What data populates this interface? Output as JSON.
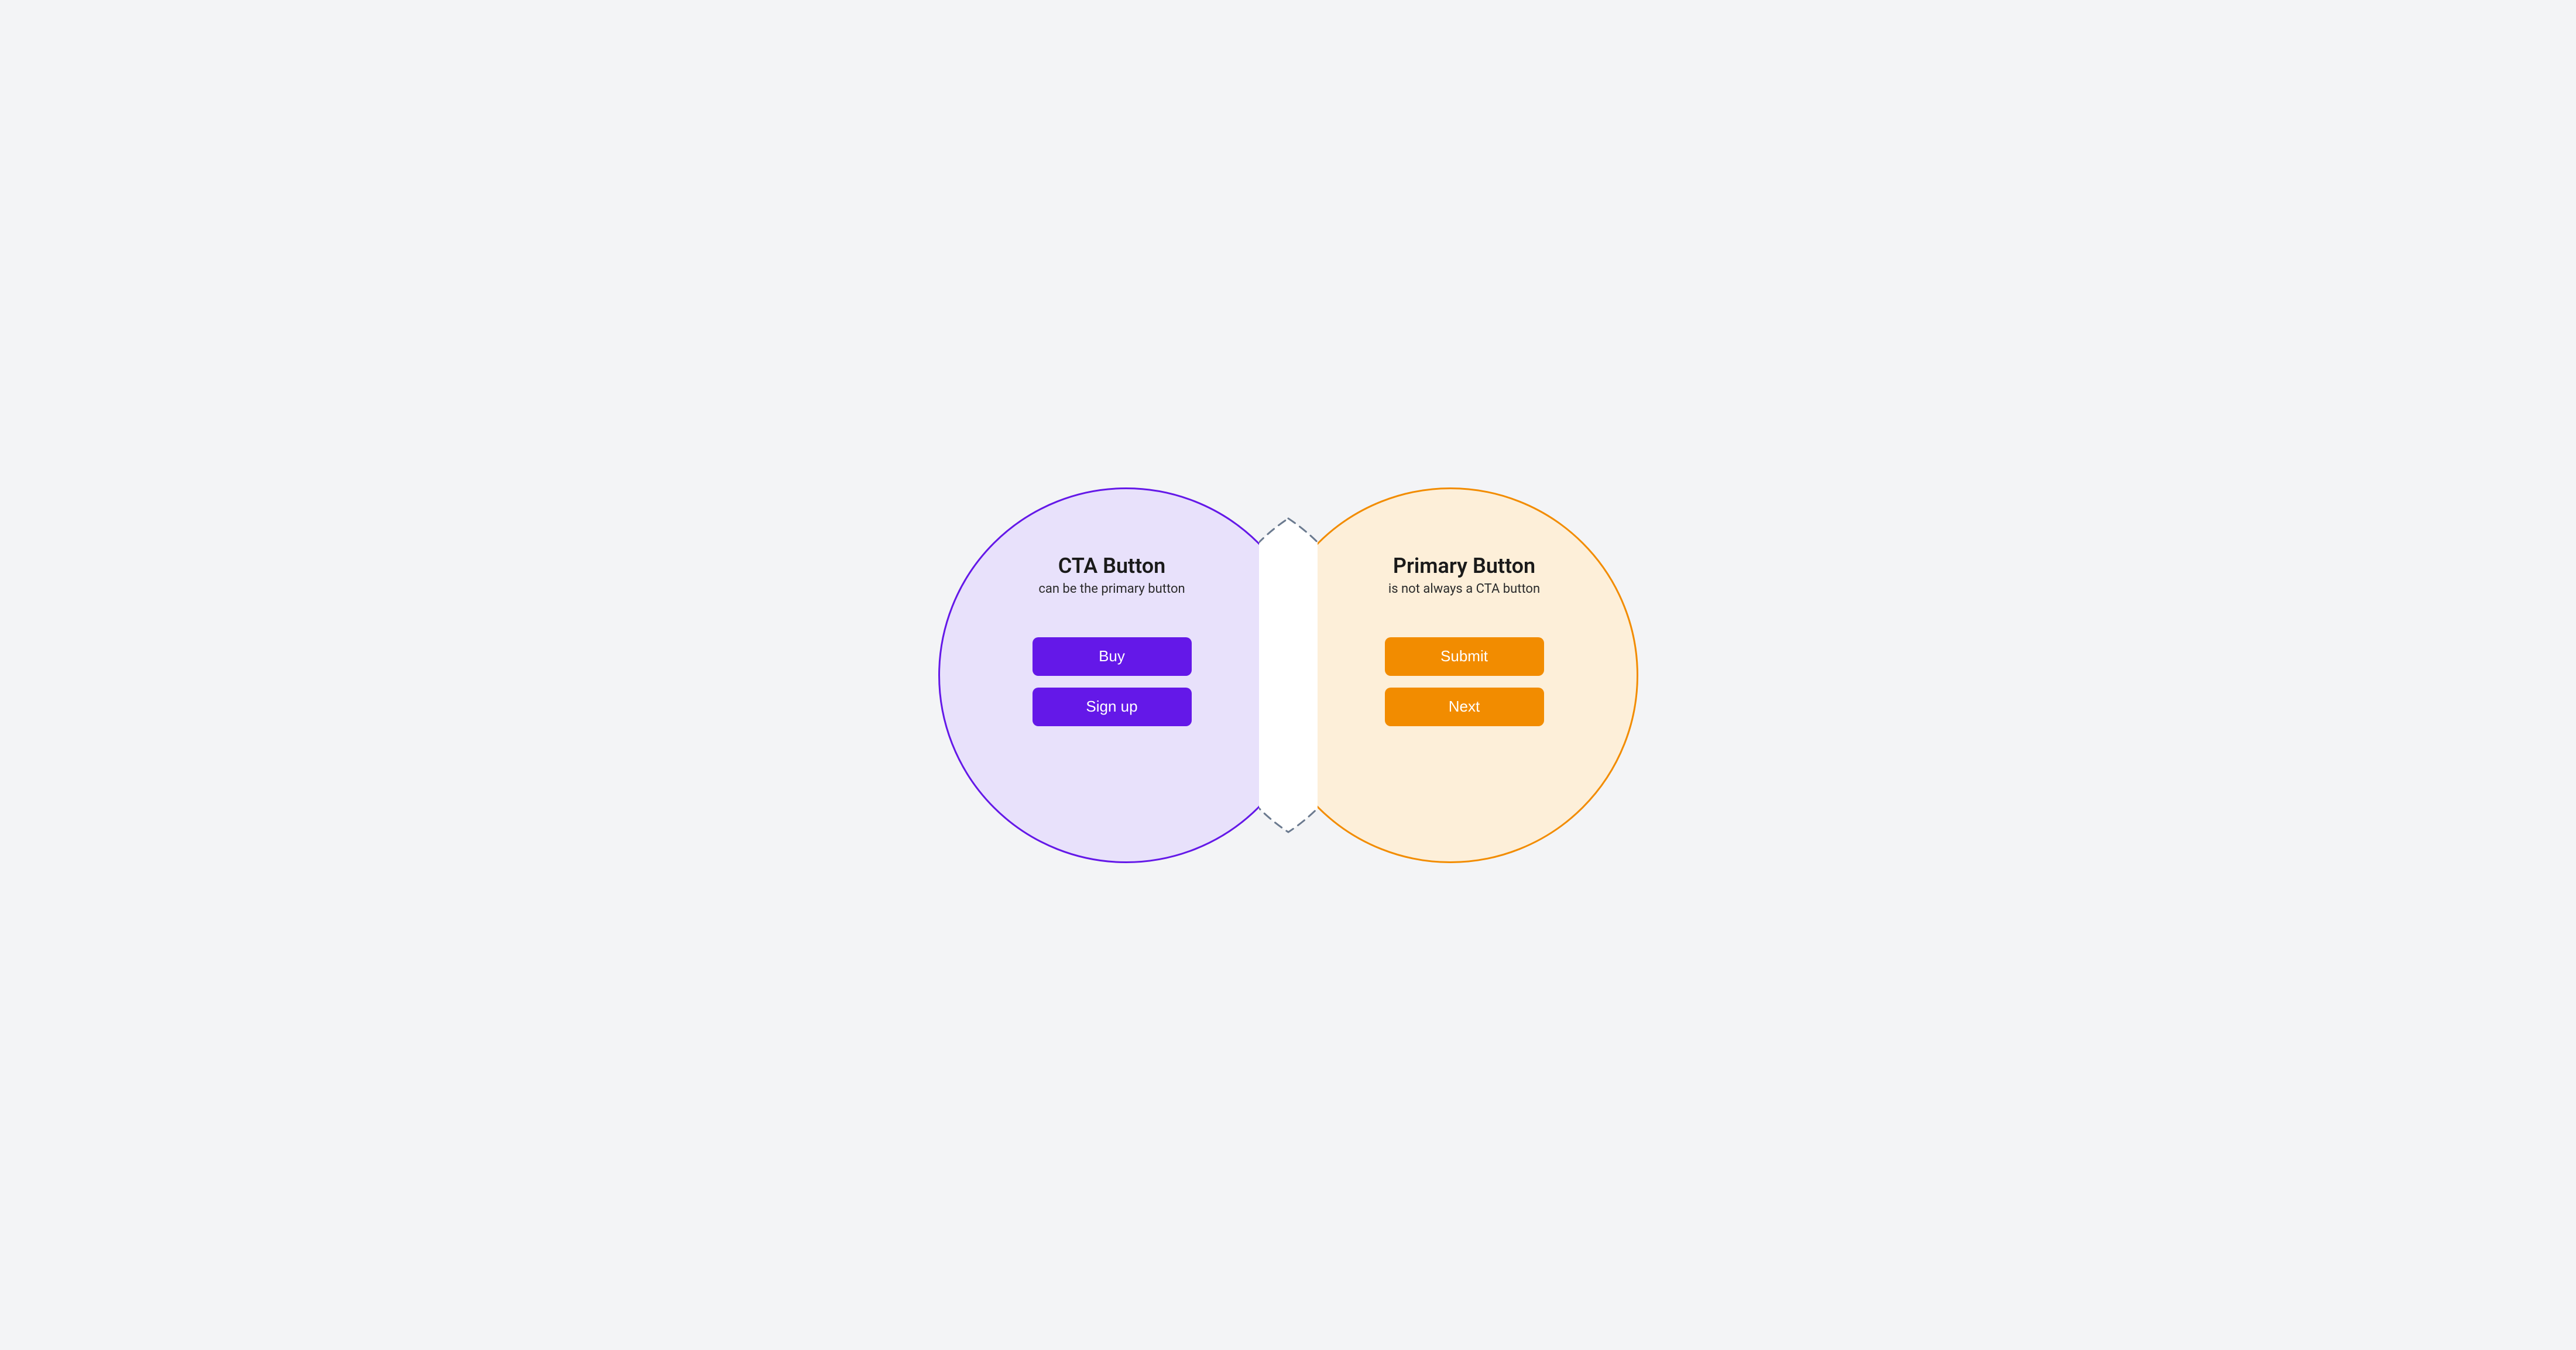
{
  "left": {
    "title": "CTA Button",
    "subtitle": "can be the primary button",
    "buttons": [
      "Buy",
      "Sign up"
    ],
    "color": "#6418e8",
    "fill": "#e8e1fb"
  },
  "right": {
    "title": "Primary Button",
    "subtitle": "is not always a CTA button",
    "buttons": [
      "Submit",
      "Next"
    ],
    "color": "#f28c00",
    "fill": "#fdefd9"
  },
  "overlap_stroke": "#6b7a8f",
  "background": "#f3f4f6"
}
